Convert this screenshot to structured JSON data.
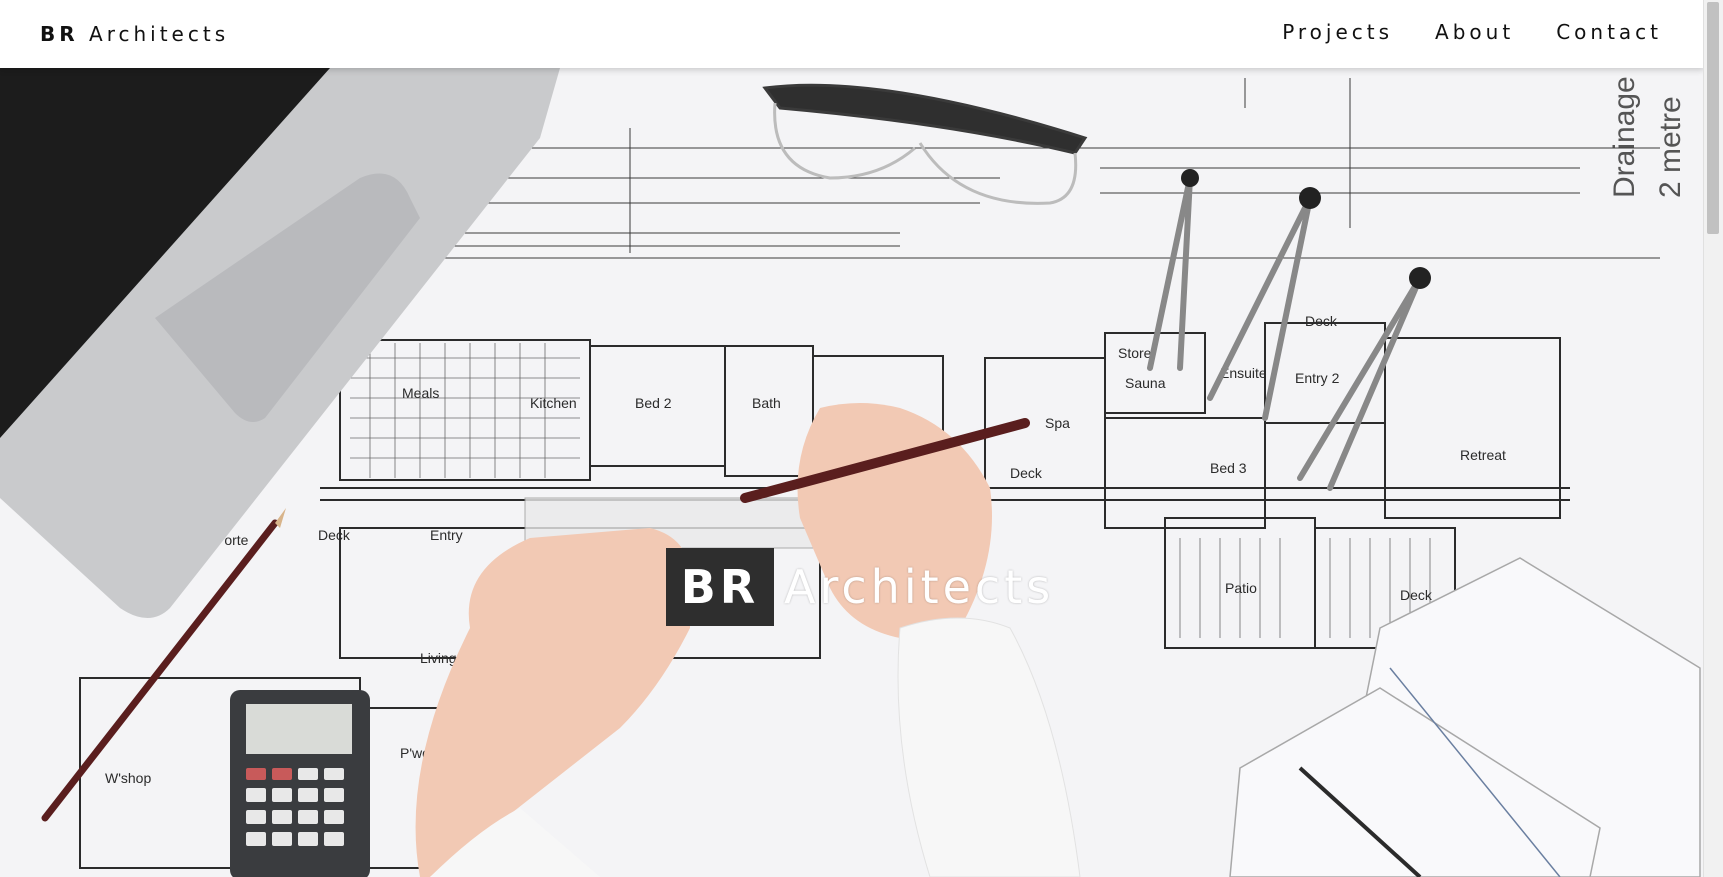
{
  "header": {
    "brand_bold": "BR",
    "brand_rest": " Architects",
    "nav": [
      {
        "label": "Projects"
      },
      {
        "label": "About"
      },
      {
        "label": "Contact"
      }
    ]
  },
  "hero": {
    "logo_box_text": "BR",
    "logo_word": "Architects",
    "plan_labels": {
      "meals": "Meals",
      "kitchen": "Kitchen",
      "bed2": "Bed 2",
      "bath": "Bath",
      "spa": "Spa",
      "sauna": "Sauna",
      "ensuite": "Ensuite",
      "entry2": "Entry 2",
      "deck_top": "Deck",
      "retreat": "Retreat",
      "bed3": "Bed 3",
      "deck_mid": "Deck",
      "deck_left": "Deck",
      "entry": "Entry",
      "porte": "Porte",
      "patio": "Patio",
      "deck_right": "Deck",
      "living": "Living",
      "wshop": "W'shop",
      "pwdr": "P'wdr",
      "store": "Store",
      "drainage": "Drainage",
      "metre": "2 metre"
    }
  },
  "colors": {
    "paper": "#f3f3f5",
    "ink": "#2b2b2b",
    "laptop": "#c9cacc",
    "keyboard": "#1a1a1a",
    "pencil": "#5a1e1e",
    "skin": "#f2c9b4"
  }
}
